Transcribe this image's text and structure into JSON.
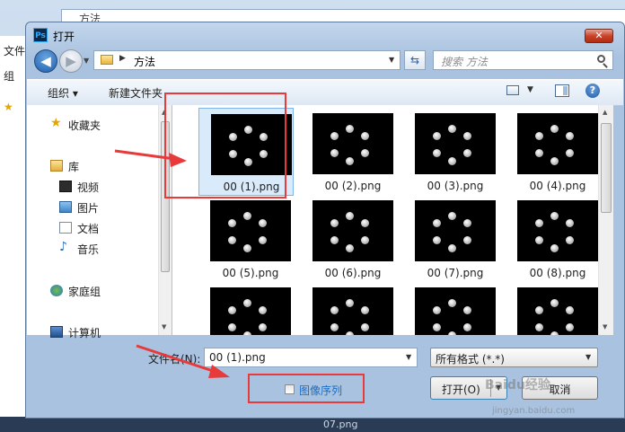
{
  "background": {
    "address_text": "方法",
    "side_items": [
      "文件",
      "组",
      "★"
    ],
    "bottom_text": "07.png"
  },
  "dialog": {
    "app_icon": "Ps",
    "title": "打开",
    "close_icon": "close-icon",
    "close_glyph": "✕",
    "back_glyph": "◀",
    "forward_glyph": "▶",
    "address": {
      "current": "方法"
    },
    "refresh_glyph": "⇆",
    "search": {
      "placeholder": "搜索 方法"
    },
    "toolbar": {
      "organize": "组织 ▾",
      "new_folder": "新建文件夹",
      "help_glyph": "?"
    },
    "nav_pane": {
      "items": [
        {
          "label": "收藏夹",
          "icon": "star-icon"
        },
        {
          "label": "库",
          "icon": "library-icon"
        },
        {
          "label": "视频",
          "icon": "video-icon"
        },
        {
          "label": "图片",
          "icon": "picture-icon"
        },
        {
          "label": "文档",
          "icon": "document-icon"
        },
        {
          "label": "音乐",
          "icon": "music-icon"
        },
        {
          "label": "家庭组",
          "icon": "homegroup-icon"
        },
        {
          "label": "计算机",
          "icon": "computer-icon"
        }
      ]
    },
    "files": [
      {
        "name": "00 (1).png",
        "selected": true
      },
      {
        "name": "00 (2).png"
      },
      {
        "name": "00 (3).png"
      },
      {
        "name": "00 (4).png"
      },
      {
        "name": "00 (5).png"
      },
      {
        "name": "00 (6).png"
      },
      {
        "name": "00 (7).png"
      },
      {
        "name": "00 (8).png"
      },
      {
        "name": ""
      },
      {
        "name": ""
      },
      {
        "name": ""
      },
      {
        "name": ""
      }
    ],
    "file_name": {
      "label": "文件名(N):",
      "value": "00 (1).png"
    },
    "file_type": {
      "value": "所有格式 (*.*)"
    },
    "image_sequence": {
      "label": "图像序列",
      "checked": false
    },
    "buttons": {
      "open": "打开(O)",
      "cancel": "取消"
    }
  },
  "annotations": {
    "color": "#e83a3a"
  },
  "watermark": {
    "text": "Baidu经验",
    "sub": "jingyan.baidu.com"
  }
}
